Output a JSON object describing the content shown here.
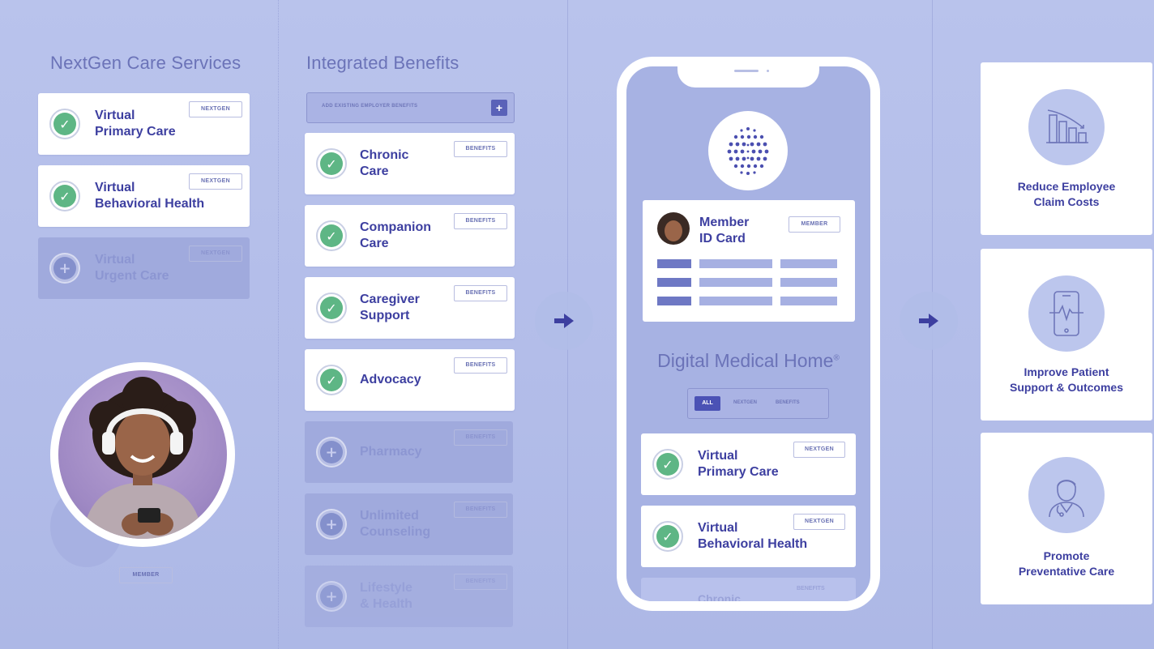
{
  "nextgen": {
    "title": "NextGen Care Services",
    "items": [
      {
        "label": "Virtual\nPrimary Care",
        "tag": "NEXTGEN",
        "active": true
      },
      {
        "label": "Virtual\nBehavioral Health",
        "tag": "NEXTGEN",
        "active": true
      },
      {
        "label": "Virtual\nUrgent Care",
        "tag": "NEXTGEN",
        "active": false
      }
    ],
    "member_tag": "MEMBER"
  },
  "benefits": {
    "title": "Integrated Benefits",
    "add_bar": "ADD EXISTING EMPLOYER BENEFITS",
    "add_icon": "+",
    "items": [
      {
        "label": "Chronic\nCare",
        "tag": "BENEFITS",
        "active": true
      },
      {
        "label": "Companion\nCare",
        "tag": "BENEFITS",
        "active": true
      },
      {
        "label": "Caregiver\nSupport",
        "tag": "BENEFITS",
        "active": true
      },
      {
        "label": "Advocacy",
        "tag": "BENEFITS",
        "active": true
      },
      {
        "label": "Pharmacy",
        "tag": "BENEFITS",
        "active": false
      },
      {
        "label": "Unlimited\nCounseling",
        "tag": "BENEFITS",
        "active": false
      },
      {
        "label": "Lifestyle\n& Health",
        "tag": "BENEFITS",
        "active": false
      }
    ]
  },
  "phone": {
    "id_card": {
      "title": "Member\nID Card",
      "tag": "MEMBER"
    },
    "home_title": "Digital Medical Home",
    "home_mark": "®",
    "filters": {
      "all": "ALL",
      "nextgen": "NEXTGEN",
      "benefits": "BENEFITS"
    },
    "items": [
      {
        "label": "Virtual\nPrimary Care",
        "tag": "NEXTGEN"
      },
      {
        "label": "Virtual\nBehavioral Health",
        "tag": "NEXTGEN"
      }
    ],
    "peek_label": "Chronic",
    "peek_tag": "BENEFITS"
  },
  "outcomes": [
    {
      "text": "Reduce Employee\nClaim Costs",
      "icon": "declining-bar-chart-icon"
    },
    {
      "text": "Improve Patient\nSupport & Outcomes",
      "icon": "phone-heartbeat-icon"
    },
    {
      "text": "Promote\nPreventative Care",
      "icon": "doctor-icon"
    }
  ],
  "colors": {
    "accent": "#3d3fa0",
    "check": "#5eb685",
    "background": "#b5bfea"
  }
}
